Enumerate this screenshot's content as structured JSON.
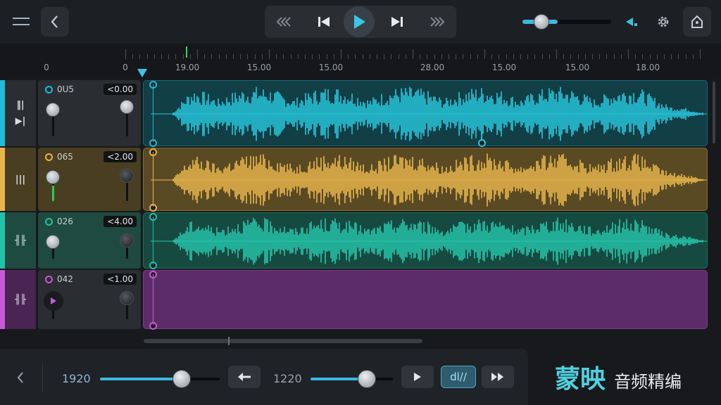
{
  "colors": {
    "accent": "#3cb8e0",
    "track1": "#20bcd6",
    "track2": "#e7b44a",
    "track3": "#22c2a8",
    "track4": "#c65ad6"
  },
  "topbar": {
    "icons": [
      "menu-icon",
      "back-chevron-icon",
      "rewind-icon",
      "skip-previous-icon",
      "play-icon",
      "skip-next-icon",
      "fast-forward-icon",
      "volume-icon",
      "gear-icon",
      "export-icon"
    ],
    "volume_level": 0.35
  },
  "ruler": {
    "labels": [
      "0",
      "0",
      "19.00",
      "15.00",
      "15.00",
      "28.00",
      "15.00",
      "15.00",
      "18.00"
    ]
  },
  "tracks": [
    {
      "name": "0U5",
      "db": "<0.00",
      "color": "track1"
    },
    {
      "name": "065",
      "db": "<2.00",
      "color": "track2"
    },
    {
      "name": "026",
      "db": "<4.00",
      "color": "track3"
    },
    {
      "name": "042",
      "db": "<1.00",
      "color": "track4"
    }
  ],
  "bottom": {
    "left_value": "1920",
    "right_value": "1220",
    "left_slider_level": 0.68,
    "right_slider_level": 0.68,
    "mode_label": "dl//"
  },
  "brand": {
    "main": "蒙映",
    "sub": "音频精编"
  }
}
